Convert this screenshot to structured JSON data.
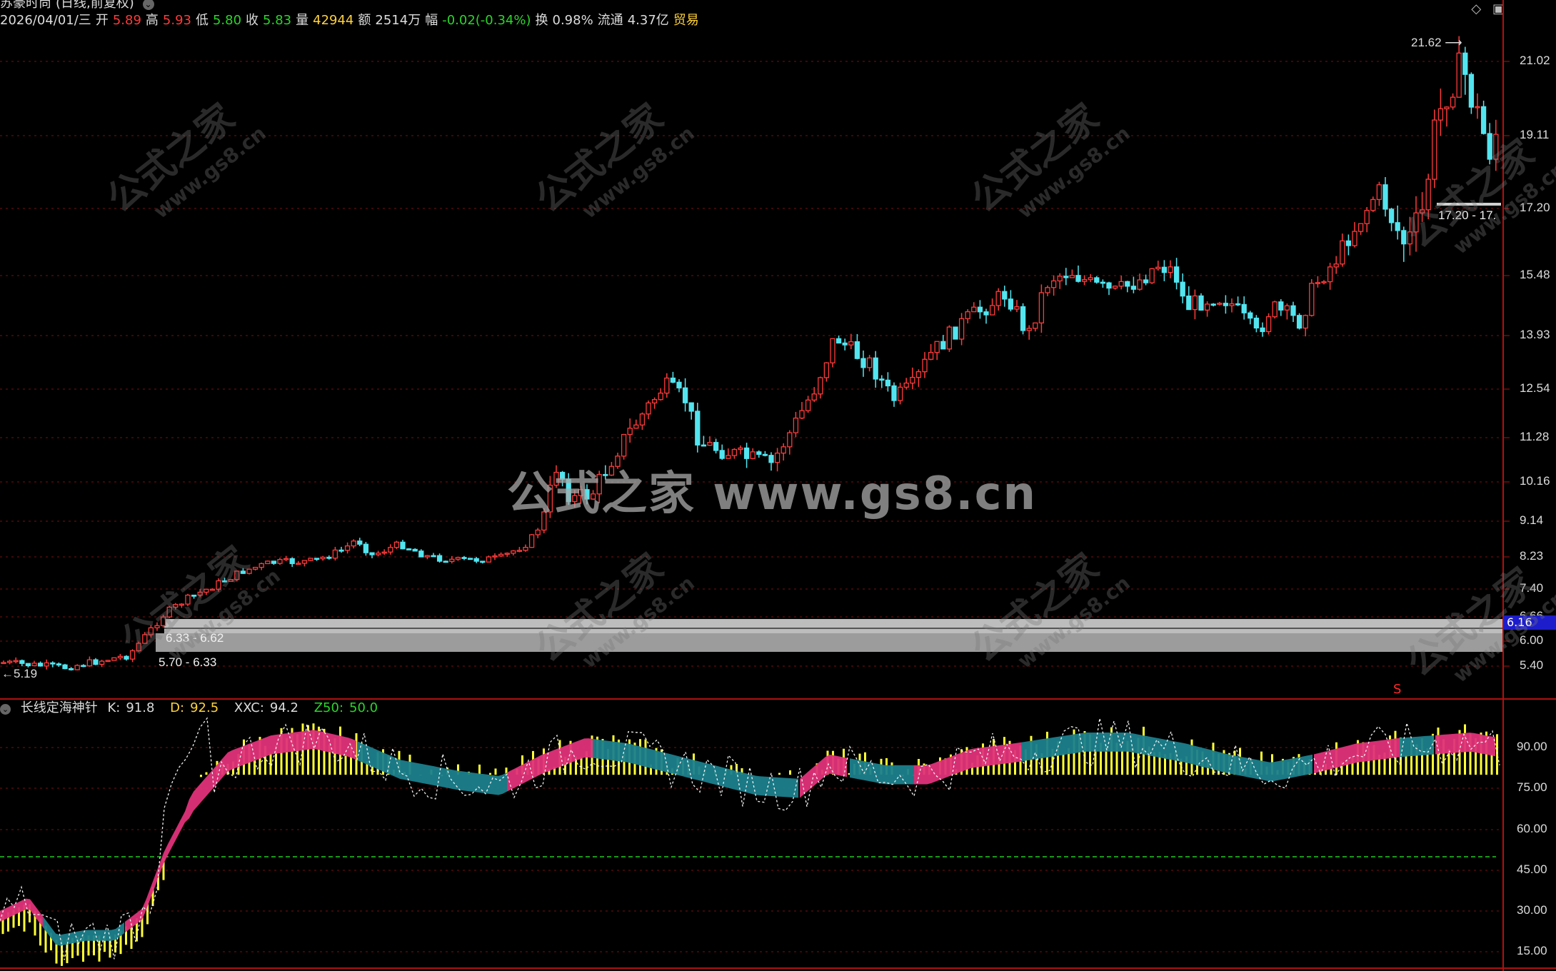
{
  "header": {
    "stock_name": "苏豪时尚",
    "mode": "(日线,前复权)",
    "date": "2026/04/01/三",
    "open_label": "开",
    "open": "5.89",
    "high_label": "高",
    "high": "5.93",
    "low_label": "低",
    "low": "5.80",
    "close_label": "收",
    "close": "5.83",
    "volume_label": "量",
    "volume": "42944",
    "amount_label": "额",
    "amount": "2514万",
    "change_label": "幅",
    "change": "-0.02(-0.34%)",
    "turnover_label": "换",
    "turnover": "0.98%",
    "float_label": "流通",
    "float": "4.37亿",
    "sector": "贸易"
  },
  "price_axis": {
    "ticks": [
      "21.02",
      "19.11",
      "17.20",
      "15.48",
      "13.93",
      "12.54",
      "11.28",
      "10.16",
      "9.14",
      "8.23",
      "7.40",
      "6.66",
      "6.00",
      "5.40"
    ],
    "current_price_tag": "6.16"
  },
  "annotations": {
    "high_marker": "21.62",
    "low_marker": "5.19",
    "zone_upper_label": "6.33 - 6.62",
    "zone_lower_label": "5.70 - 6.33",
    "right_zone_label": "17.20 - 17.",
    "signal_marker": "S"
  },
  "watermark": {
    "center_text": "公式之家 www.gs8.cn",
    "tile_main": "公式之家",
    "tile_sub": "www.gs8.cn"
  },
  "indicator": {
    "name": "长线定海神针",
    "k_label": "K:",
    "k": "91.8",
    "d_label": "D:",
    "d": "92.5",
    "xxc_label": "XXC:",
    "xxc": "94.2",
    "z50_label": "Z50:",
    "z50": "50.0",
    "ticks": [
      "90.00",
      "75.00",
      "60.00",
      "45.00",
      "30.00",
      "15.00"
    ]
  },
  "colors": {
    "up": "#ff3a3a",
    "down": "#52e5f0",
    "bg": "#000000",
    "grid": "#7a1010",
    "bar": "#ffff33",
    "ribbon_up": "#e0317a",
    "ribbon_down": "#1b7f8c",
    "zline": "#22cc22"
  }
}
